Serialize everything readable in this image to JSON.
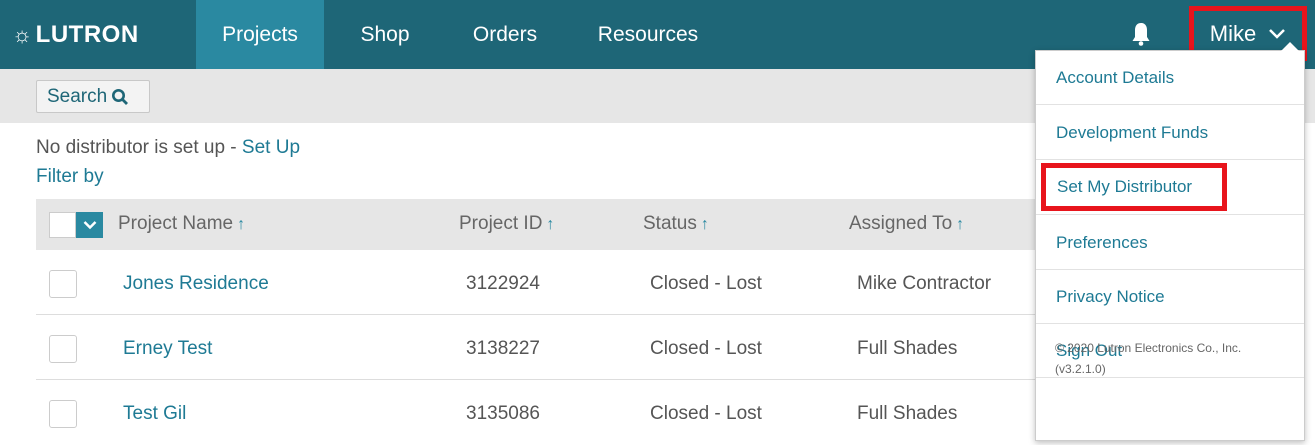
{
  "header": {
    "logo": "LUTRON",
    "nav": [
      "Projects",
      "Shop",
      "Orders",
      "Resources"
    ],
    "active_nav": "Projects",
    "user": "Mike"
  },
  "toolbar": {
    "search_label": "Search"
  },
  "distributor": {
    "message": "No distributor is set up - ",
    "setup_link": "Set Up"
  },
  "filter_label": "Filter by",
  "table": {
    "columns": [
      "Project Name",
      "Project ID",
      "Status",
      "Assigned To"
    ],
    "rows": [
      {
        "name": "Jones Residence",
        "id": "3122924",
        "status": "Closed - Lost",
        "assigned": "Mike Contractor"
      },
      {
        "name": "Erney Test",
        "id": "3138227",
        "status": "Closed - Lost",
        "assigned": "Full Shades"
      },
      {
        "name": "Test Gil",
        "id": "3135086",
        "status": "Closed - Lost",
        "assigned": "Full Shades"
      }
    ]
  },
  "user_menu": {
    "items": [
      "Account Details",
      "Development Funds",
      "Set My Distributor",
      "Preferences",
      "Privacy Notice",
      "Sign Out"
    ],
    "highlighted": "Set My Distributor",
    "copyright": "© 2020 Lutron Electronics Co., Inc.",
    "version": "(v3.2.1.0)"
  },
  "colors": {
    "header": "#1e6677",
    "active_tab": "#2a89a1",
    "link": "#1e7a94",
    "highlight": "#e8141c"
  }
}
